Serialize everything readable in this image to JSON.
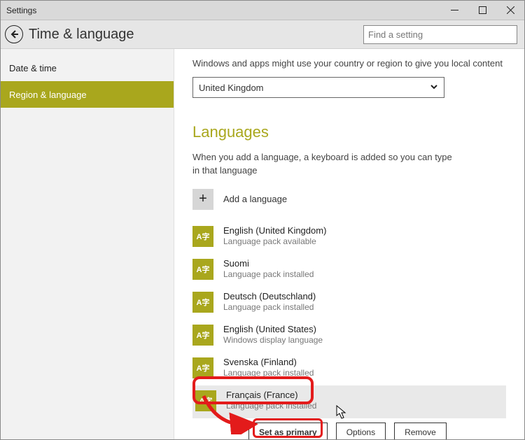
{
  "window": {
    "title": "Settings"
  },
  "header": {
    "page_title": "Time & language"
  },
  "search": {
    "placeholder": "Find a setting"
  },
  "sidebar": {
    "items": [
      {
        "label": "Date & time",
        "active": false
      },
      {
        "label": "Region & language",
        "active": true
      }
    ]
  },
  "region": {
    "hint": "Windows and apps might use your country or region to give you local content",
    "selected": "United Kingdom"
  },
  "languages": {
    "title": "Languages",
    "subtitle": "When you add a language, a keyboard is added so you can type in that language",
    "add_label": "Add a language",
    "icon_glyph": "A字",
    "items": [
      {
        "name": "English (United Kingdom)",
        "status": "Language pack available"
      },
      {
        "name": "Suomi",
        "status": "Language pack installed"
      },
      {
        "name": "Deutsch (Deutschland)",
        "status": "Language pack installed"
      },
      {
        "name": "English (United States)",
        "status": "Windows display language"
      },
      {
        "name": "Svenska (Finland)",
        "status": "Language pack installed"
      },
      {
        "name": "Français (France)",
        "status": "Language pack installed"
      }
    ]
  },
  "actions": {
    "set_primary": "Set as primary",
    "options": "Options",
    "remove": "Remove"
  },
  "colors": {
    "accent": "#a9a71d",
    "annotation": "#e31b1b"
  }
}
